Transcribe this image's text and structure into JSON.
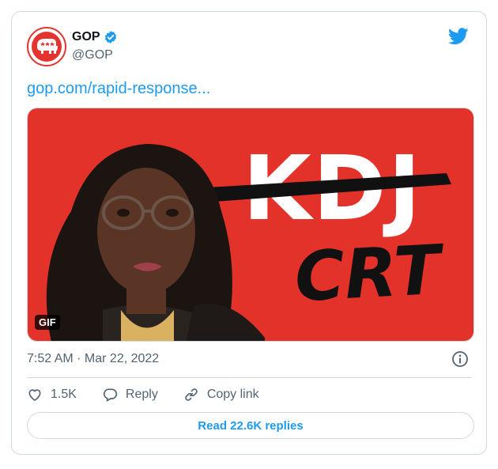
{
  "tweet": {
    "display_name": "GOP",
    "handle": "@GOP",
    "verified": true,
    "link_text": "gop.com/rapid-response...",
    "timestamp": "7:52 AM · Mar 22, 2022"
  },
  "media": {
    "headline_text": "KDJ",
    "scrawl_text": "CRT",
    "badge": "GIF",
    "background_color": "#e8342b"
  },
  "actions": {
    "likes_count": "1.5K",
    "reply_label": "Reply",
    "copy_link_label": "Copy link",
    "read_replies_label": "Read 22.6K replies"
  },
  "icons": [
    "gop-elephant-logo",
    "verified-badge-icon",
    "twitter-bird-icon",
    "info-icon",
    "heart-icon",
    "reply-icon",
    "link-icon"
  ],
  "colors": {
    "accent": "#1d9bf0",
    "secondary_text": "#536471",
    "border": "#cfd9de",
    "logo_red": "#e3342f"
  }
}
